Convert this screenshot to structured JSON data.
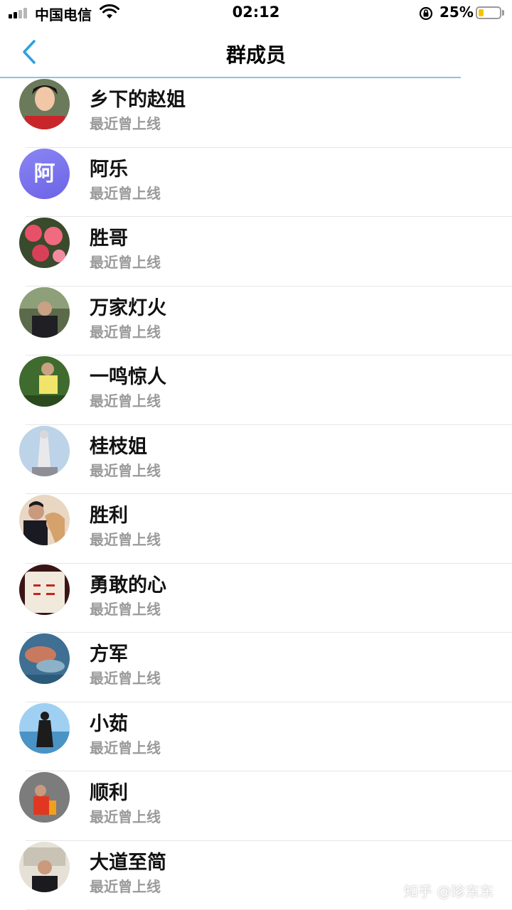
{
  "status_bar": {
    "carrier": "中国电信",
    "time": "02:12",
    "battery_percent": "25%",
    "battery_level": 0.25,
    "battery_color": "#f5c400"
  },
  "nav": {
    "title": "群成员",
    "back_icon": "chevron-left-icon",
    "accent": "#2aa0e0"
  },
  "members": [
    {
      "name": "乡下的赵姐",
      "status": "最近曾上线",
      "avatar": "photo"
    },
    {
      "name": "阿乐",
      "status": "最近曾上线",
      "avatar_letter": "阿"
    },
    {
      "name": "胜哥",
      "status": "最近曾上线",
      "avatar": "photo"
    },
    {
      "name": "万家灯火",
      "status": "最近曾上线",
      "avatar": "photo"
    },
    {
      "name": "一鸣惊人",
      "status": "最近曾上线",
      "avatar": "photo"
    },
    {
      "name": "桂枝姐",
      "status": "最近曾上线",
      "avatar": "photo"
    },
    {
      "name": "胜利",
      "status": "最近曾上线",
      "avatar": "photo"
    },
    {
      "name": "勇敢的心",
      "status": "最近曾上线",
      "avatar": "photo"
    },
    {
      "name": "方军",
      "status": "最近曾上线",
      "avatar": "photo"
    },
    {
      "name": "小茹",
      "status": "最近曾上线",
      "avatar": "photo"
    },
    {
      "name": "顺利",
      "status": "最近曾上线",
      "avatar": "photo"
    },
    {
      "name": "大道至简",
      "status": "最近曾上线",
      "avatar": "photo"
    }
  ],
  "watermark": "知乎 @珍东东"
}
